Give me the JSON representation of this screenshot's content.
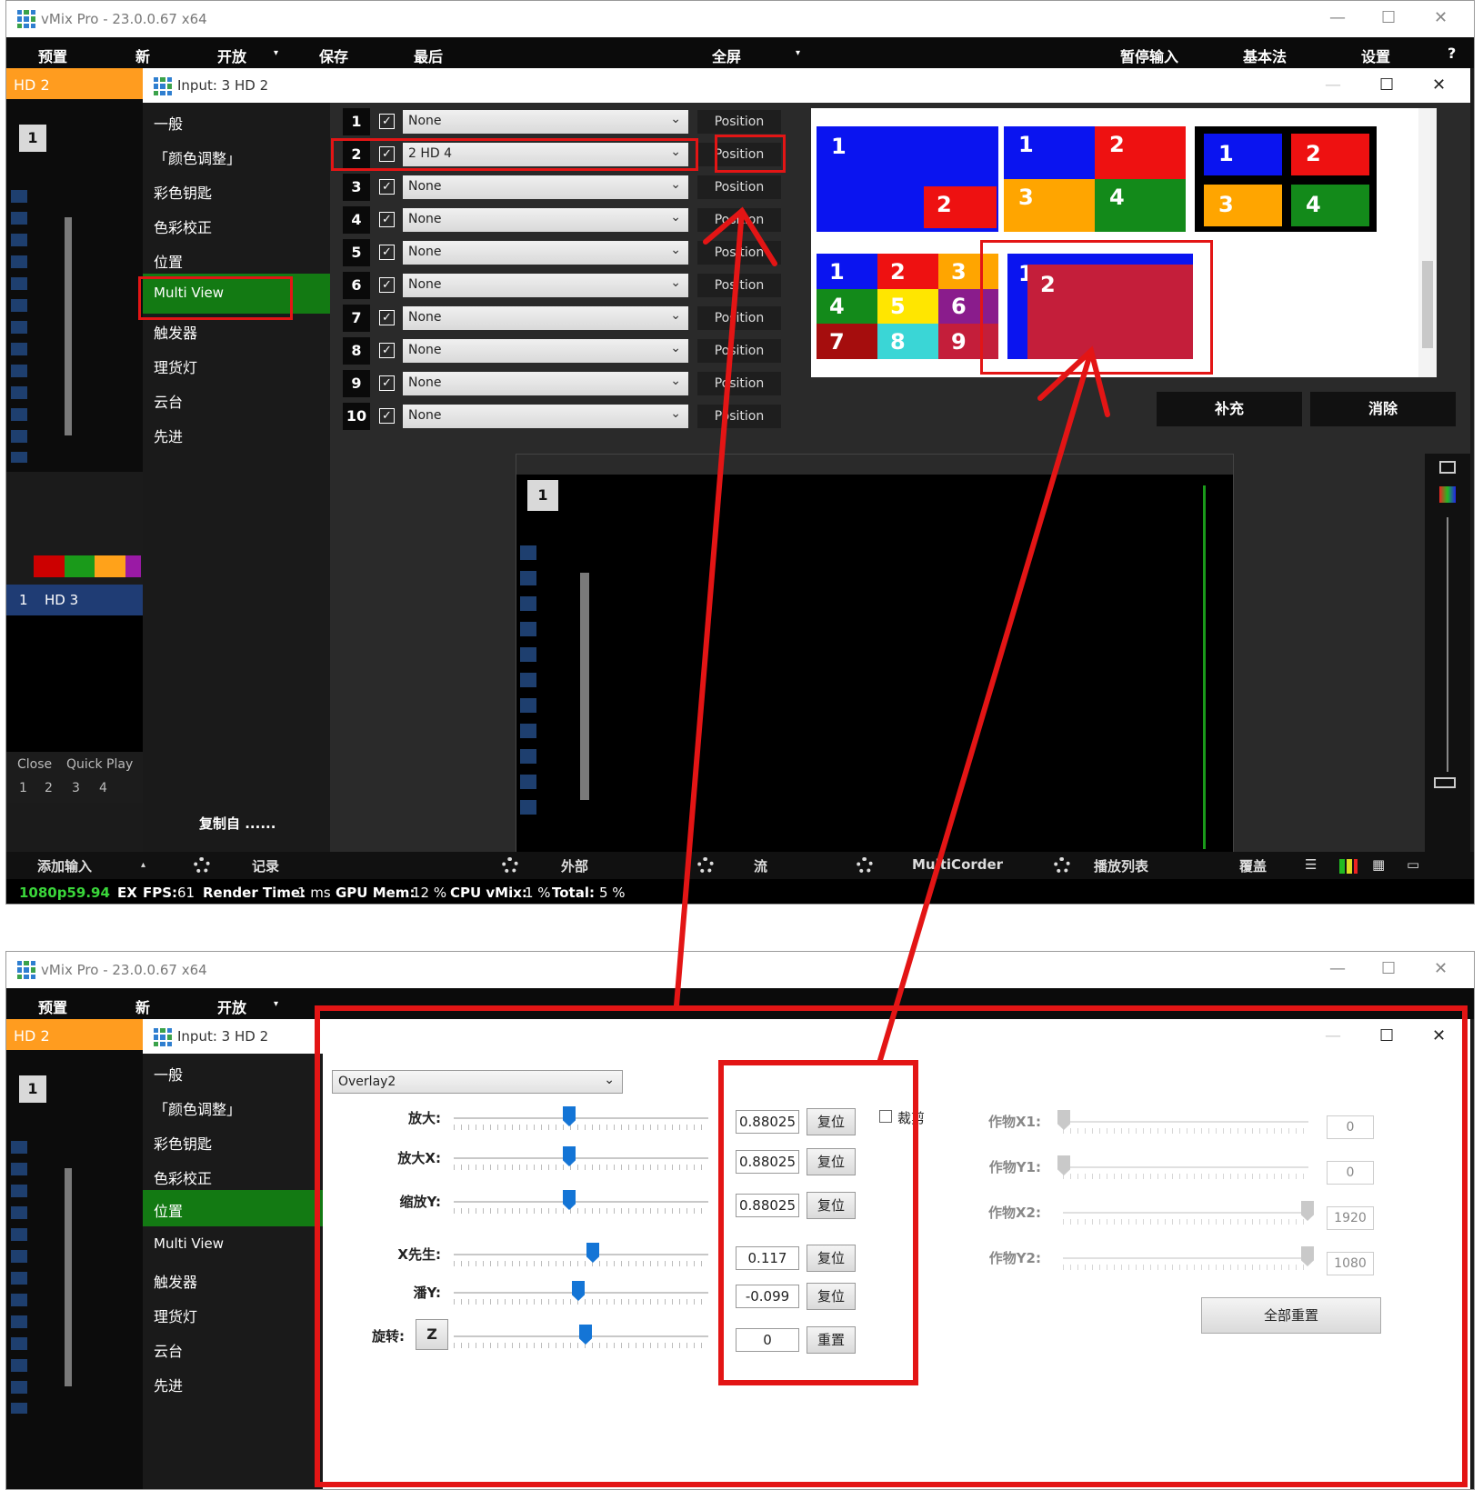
{
  "app": {
    "title": "vMix Pro - 23.0.0.67 x64",
    "win_min": "—",
    "win_max": "☐",
    "win_close": "✕"
  },
  "menu": {
    "preset": "预置",
    "new": "新",
    "open": "开放",
    "save": "保存",
    "last": "最后",
    "fullscreen": "全屏",
    "pause_input": "暂停输入",
    "basic": "基本法",
    "settings": "设置",
    "help": "?"
  },
  "left": {
    "active_input": "HD 2",
    "preview_number": "1",
    "list_index": "1",
    "list_name": "HD 3",
    "close": "Close",
    "quick_play": "Quick Play",
    "pages": [
      "1",
      "2",
      "3",
      "4"
    ],
    "add_input": "添加输入"
  },
  "dialog": {
    "title": "Input: 3 HD 2",
    "min": "—",
    "max": "☐",
    "close": "✕",
    "copy_from": "复制自 ......"
  },
  "nav_top": [
    "一般",
    "「颜色调整」",
    "彩色钥匙",
    "色彩校正",
    "位置",
    "Multi View",
    "触发器",
    "理货灯",
    "云台",
    "先进"
  ],
  "nav_bottom": [
    "一般",
    "「颜色调整」",
    "彩色钥匙",
    "色彩校正",
    "位置",
    "Multi View",
    "触发器",
    "理货灯",
    "云台",
    "先进"
  ],
  "multiview": {
    "rows": [
      {
        "n": "1",
        "value": "None",
        "btn": "Position"
      },
      {
        "n": "2",
        "value": "2 HD 4",
        "btn": "Position"
      },
      {
        "n": "3",
        "value": "None",
        "btn": "Position"
      },
      {
        "n": "4",
        "value": "None",
        "btn": "Position"
      },
      {
        "n": "5",
        "value": "None",
        "btn": "Position"
      },
      {
        "n": "6",
        "value": "None",
        "btn": "Position"
      },
      {
        "n": "7",
        "value": "None",
        "btn": "Position"
      },
      {
        "n": "8",
        "value": "None",
        "btn": "Position"
      },
      {
        "n": "9",
        "value": "None",
        "btn": "Position"
      },
      {
        "n": "10",
        "value": "None",
        "btn": "Position"
      }
    ],
    "checkmark": "✓",
    "chevron": "⌄",
    "supplement": "补充",
    "clear": "消除",
    "layout_labels": {
      "a": [
        "1",
        "2"
      ],
      "b": [
        "1",
        "2",
        "3",
        "4"
      ],
      "c": [
        "1",
        "2",
        "3",
        "4"
      ],
      "d": [
        "1",
        "2",
        "3",
        "4",
        "5",
        "6",
        "7",
        "8",
        "9"
      ],
      "e": [
        "1",
        "2"
      ]
    }
  },
  "colors": {
    "blue": "#0a14f0",
    "red": "#ee1111",
    "orange": "#ffa500",
    "green": "#138a1a",
    "yellow": "#ffe600",
    "purple": "#8a1c8c",
    "darkred": "#a50d0d",
    "cyan": "#3ad6d6",
    "crimson": "#c41e3a",
    "accent_orange": "#ff9c1f",
    "highlight_green": "#137a13",
    "annotation": "#e31515"
  },
  "statusbar": {
    "format": "1080p59.94",
    "ex": "EX",
    "fps_label": "FPS:",
    "fps": "61",
    "render_label": "Render Time:",
    "render": "1 ms",
    "gpu_label": "GPU Mem:",
    "gpu": "12 %",
    "cpu_label": "CPU vMix:",
    "cpu": "1 %",
    "total_label": "Total:",
    "total": "5 %"
  },
  "bottombar": {
    "record": "记录",
    "external": "外部",
    "stream": "流",
    "multicorder": "MultiCorder",
    "playlist": "播放列表",
    "overlay": "覆盖"
  },
  "position": {
    "overlay_select": "Overlay2",
    "zoom_label": "放大:",
    "zoomx_label": "放大X:",
    "zoomy_label": "缩放Y:",
    "x_label": "X先生:",
    "y_label": "潘Y:",
    "rotate_label": "旋转:",
    "z_button": "Z",
    "zoom": "0.88025",
    "zoomx": "0.88025",
    "zoomy": "0.88025",
    "x": "0.117",
    "y": "-0.099",
    "rotate": "0",
    "reset": "复位",
    "reset2": "重置",
    "crop_label": "裁剪",
    "cropx1_label": "作物X1:",
    "cropy1_label": "作物Y1:",
    "cropx2_label": "作物X2:",
    "cropy2_label": "作物Y2:",
    "cropx1": "0",
    "cropy1": "0",
    "cropx2": "1920",
    "cropy2": "1080",
    "reset_all": "全部重置"
  }
}
